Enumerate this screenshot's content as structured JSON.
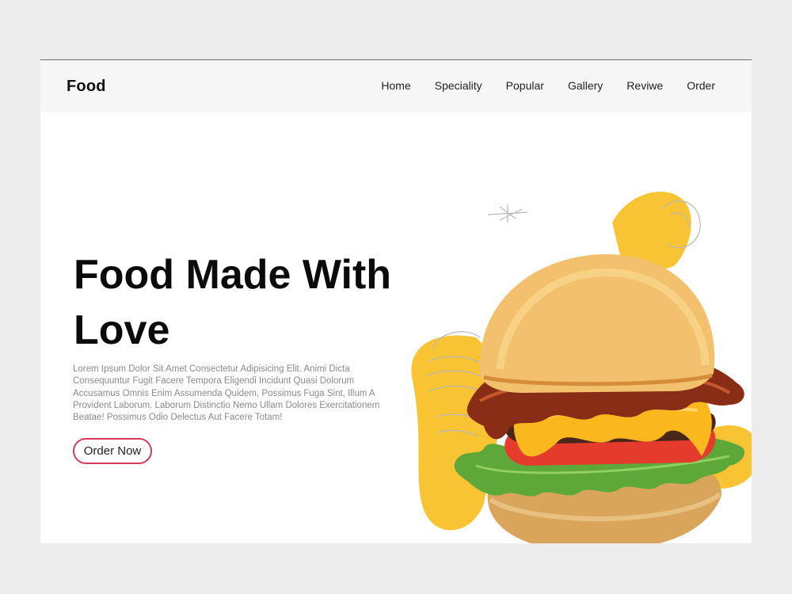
{
  "nav": {
    "brand": "Food",
    "links": [
      "Home",
      "Speciality",
      "Popular",
      "Gallery",
      "Reviwe",
      "Order"
    ]
  },
  "hero": {
    "title_line1": "Food Made With",
    "title_line2": "Love",
    "description": "Lorem Ipsum Dolor Sit Amet Consectetur Adipisicing Elit. Animi Dicta Consequuntur Fugit Facere Tempora Eligendi Incidunt Quasi Dolorum Accusamus Omnis Enim Assumenda Quidem, Possimus Fuga Sint, Illum A Provident Laborum. Laborum Distinctio Nemo Ullam Dolores Exercitationem Beatae! Possimus Odio Delectus Aut Facere Totam!",
    "cta_label": "Order Now"
  },
  "colors": {
    "accent_yellow": "#f9c433",
    "button_border": "#d6395a",
    "navbar_bg": "#f6f6f6"
  }
}
